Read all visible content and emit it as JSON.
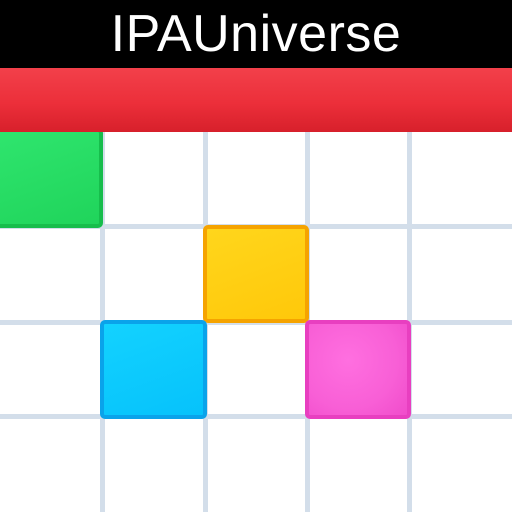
{
  "watermark": {
    "text": "IPAUniverse"
  },
  "app_icon": {
    "icon_name": "calendar-grid-icon",
    "colors": {
      "header_band": "#ec2f3a",
      "grid_lines": "#d3deea",
      "green_block": "#20d45b",
      "yellow_block": "#ffc80a",
      "cyan_block": "#06c2fb",
      "pink_block": "#f85fd6",
      "background": "#ffffff"
    }
  }
}
